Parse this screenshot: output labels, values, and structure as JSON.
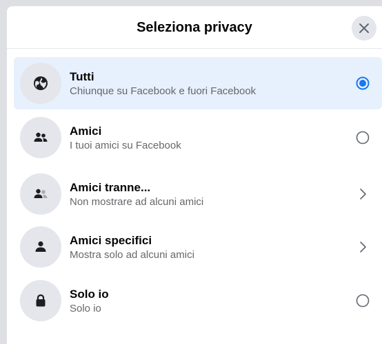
{
  "dialog": {
    "title": "Seleziona privacy",
    "close_icon": "close-icon"
  },
  "options": [
    {
      "title": "Tutti",
      "subtitle": "Chiunque su Facebook e fuori Facebook",
      "icon": "globe-icon",
      "control": "radio",
      "selected": true
    },
    {
      "title": "Amici",
      "subtitle": "I tuoi amici su Facebook",
      "icon": "friends-icon",
      "control": "radio",
      "selected": false
    },
    {
      "title": "Amici tranne...",
      "subtitle": "Non mostrare ad alcuni amici",
      "icon": "friends-except-icon",
      "control": "chevron",
      "selected": false
    },
    {
      "title": "Amici specifici",
      "subtitle": "Mostra solo ad alcuni amici",
      "icon": "person-icon",
      "control": "chevron",
      "selected": false
    },
    {
      "title": "Solo io",
      "subtitle": "Solo io",
      "icon": "lock-icon",
      "control": "radio",
      "selected": false
    }
  ],
  "colors": {
    "accent": "#1877f2",
    "selected_bg": "#e7f0fd",
    "icon_bg": "#e4e6eb",
    "icon_fg": "#1c1e21",
    "secondary_text": "#65676b"
  }
}
